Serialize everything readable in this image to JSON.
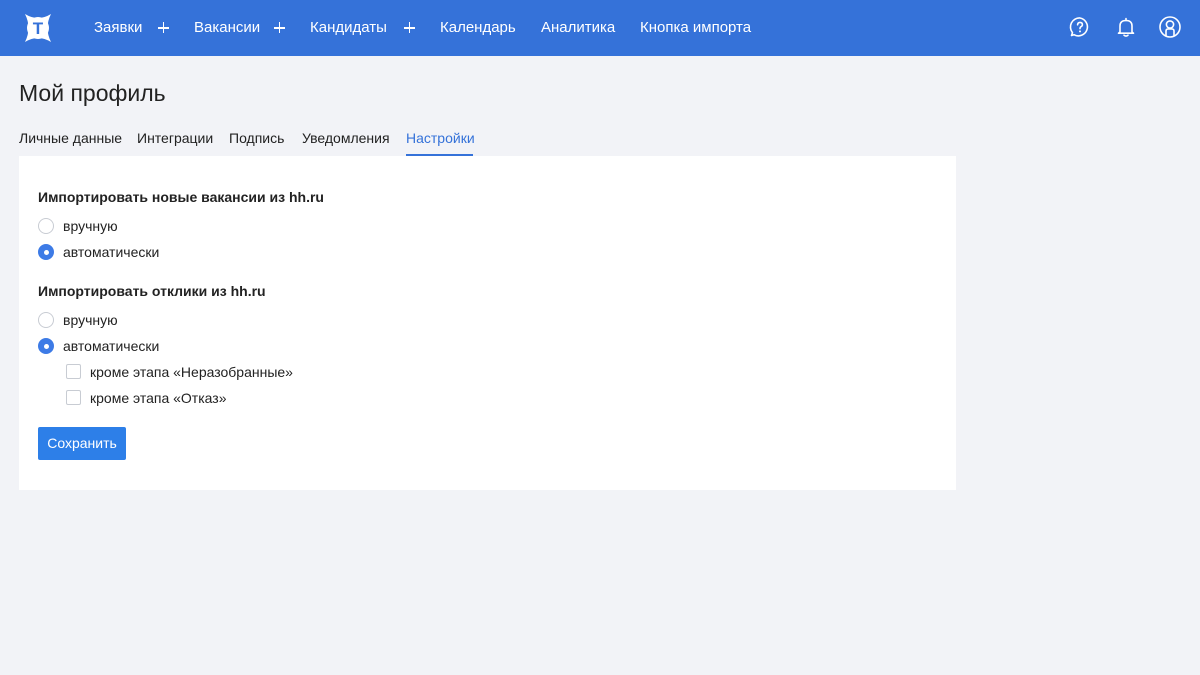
{
  "colors": {
    "topbar": "#3572d9",
    "accent": "#3572d9",
    "button": "#2d7fe8",
    "page_background": "#f2f3f7",
    "card_background": "#ffffff"
  },
  "header": {
    "logo_letter": "T",
    "nav": [
      {
        "label": "Заявки",
        "has_add": true
      },
      {
        "label": "Вакансии",
        "has_add": true
      },
      {
        "label": "Кандидаты",
        "has_add": true
      },
      {
        "label": "Календарь",
        "has_add": false
      },
      {
        "label": "Аналитика",
        "has_add": false
      },
      {
        "label": "Кнопка импорта",
        "has_add": false
      }
    ],
    "icons": [
      "help-icon",
      "bell-icon",
      "user-icon"
    ]
  },
  "page": {
    "title": "Мой профиль",
    "tabs": [
      {
        "label": "Личные данные",
        "active": false
      },
      {
        "label": "Интеграции",
        "active": false
      },
      {
        "label": "Подпись",
        "active": false
      },
      {
        "label": "Уведомления",
        "active": false
      },
      {
        "label": "Настройки",
        "active": true
      }
    ]
  },
  "settings": {
    "vacancies": {
      "title": "Импортировать новые вакансии из hh.ru",
      "options": [
        {
          "label": "вручную",
          "selected": false
        },
        {
          "label": "автоматически",
          "selected": true
        }
      ]
    },
    "responses": {
      "title": "Импортировать отклики из hh.ru",
      "options": [
        {
          "label": "вручную",
          "selected": false
        },
        {
          "label": "автоматически",
          "selected": true
        }
      ],
      "exceptions": [
        {
          "label": "кроме этапа «Неразобранные»",
          "checked": false
        },
        {
          "label": "кроме этапа «Отказ»",
          "checked": false
        }
      ]
    },
    "save_label": "Сохранить"
  }
}
